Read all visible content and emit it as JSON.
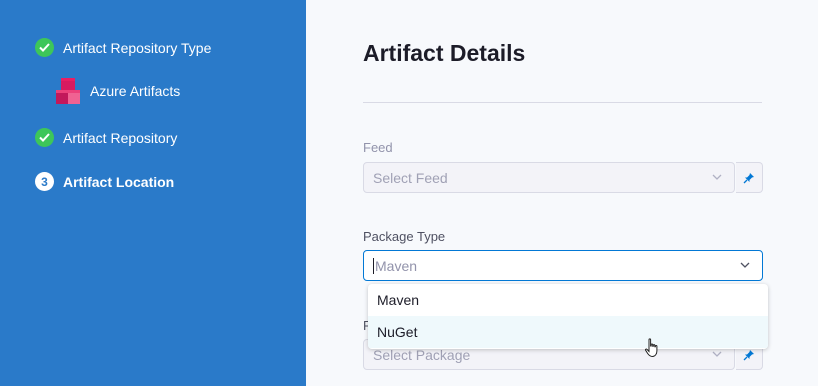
{
  "sidebar": {
    "steps": [
      {
        "label": "Artifact Repository Type",
        "state": "done"
      },
      {
        "label": "Artifact Repository",
        "state": "done"
      },
      {
        "label": "Artifact Location",
        "state": "current",
        "number": "3"
      }
    ],
    "selected_type": {
      "label": "Azure Artifacts",
      "icon": "azure-artifacts-icon"
    }
  },
  "main": {
    "title": "Artifact Details",
    "feed": {
      "label": "Feed",
      "placeholder": "Select Feed"
    },
    "package_type": {
      "label": "Package Type",
      "value": "Maven",
      "options": [
        "Maven",
        "NuGet"
      ]
    },
    "package": {
      "label": "P",
      "placeholder": "Select Package"
    }
  },
  "colors": {
    "sidebar_bg": "#2a7ac9",
    "done": "#3dc659",
    "focus_border": "#0278d5"
  }
}
